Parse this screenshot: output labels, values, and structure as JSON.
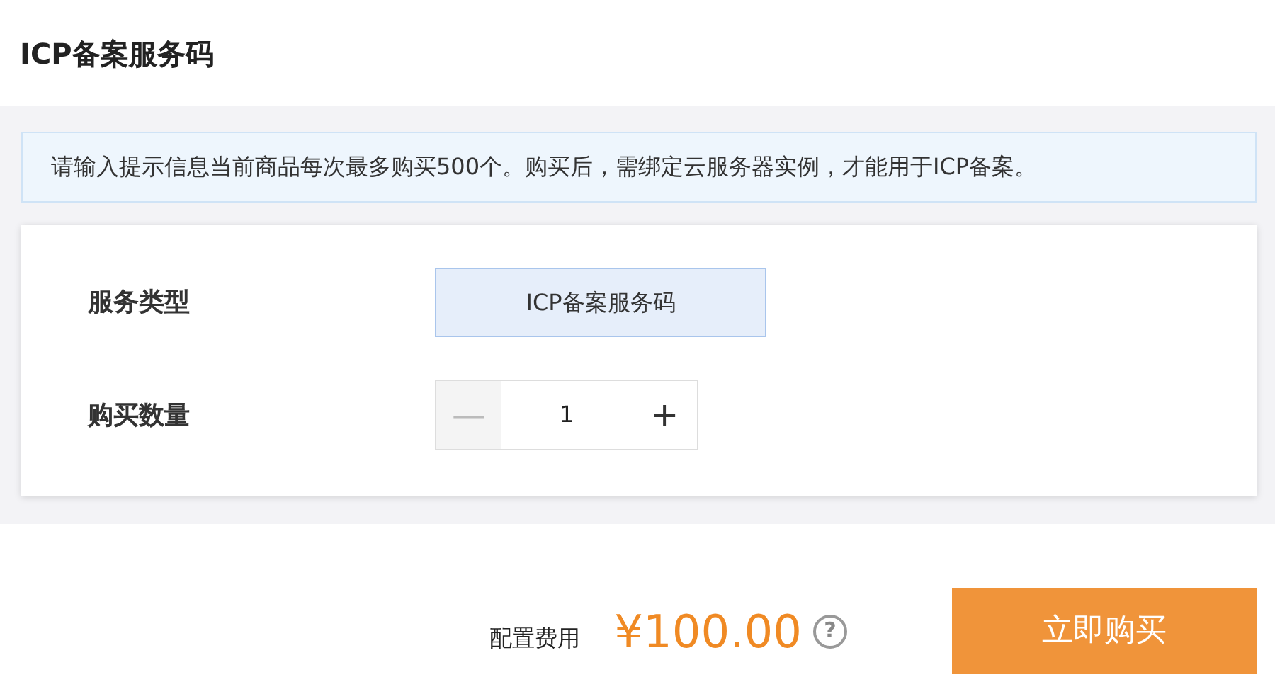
{
  "page_title": "ICP备案服务码",
  "notice": "请输入提示信息当前商品每次最多购买500个。购买后，需绑定云服务器实例，才能用于ICP备案。",
  "form": {
    "rows": [
      {
        "kind": "options",
        "label": "服务类型",
        "options": [
          {
            "label": "ICP备案服务码",
            "selected": true
          }
        ]
      },
      {
        "kind": "stepper",
        "label": "购买数量",
        "minus": "—",
        "minus_disabled": true,
        "value": "1",
        "plus": "+"
      }
    ]
  },
  "footer": {
    "price_label": "配置费用",
    "price": "¥100.00",
    "help": "?",
    "buy_button": "立即购买"
  }
}
